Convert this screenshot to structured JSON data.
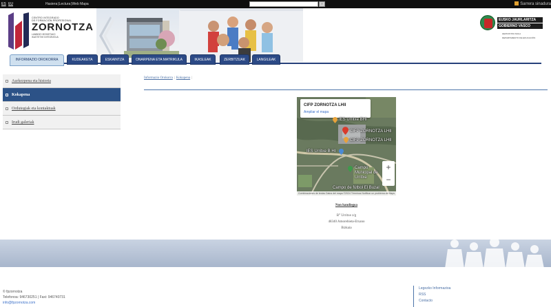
{
  "topbar": {
    "lang_es": "ES",
    "lang_eu": "EU",
    "links": [
      "Hasiera",
      "Lectura",
      "Web Mapa"
    ],
    "signature_link": "Sarrera sinadura"
  },
  "header": {
    "logo_line1": "CENTRO INTEGRADO",
    "logo_line2": "DE FORMACIÓN PROFESIONAL",
    "logo_name": "ZORNOTZA",
    "logo_line3": "LANBIDE HEZIKETAKO",
    "logo_line4": "IKASTETXE INTEGRATUA",
    "gv_line1": "EUSKO JAURLARITZA",
    "gv_line2": "GOBIERNO VASCO",
    "gv_sub1": "HEZKUNTZA SAILA",
    "gv_sub2": "DEPARTAMENTO DE EDUCACIÓN"
  },
  "nav": {
    "tabs": [
      {
        "label": "INFORMAZIO OROKORRA",
        "active": true
      },
      {
        "label": "KUDEAKETA",
        "active": false
      },
      {
        "label": "ESKAINTZA",
        "active": false
      },
      {
        "label": "ONARPENA ETA MATRIKULA",
        "active": false
      },
      {
        "label": "IKASLEAK",
        "active": false
      },
      {
        "label": "ZERBITZUAK",
        "active": false
      },
      {
        "label": "LANGILEAK",
        "active": false
      }
    ]
  },
  "sidebar": {
    "items": [
      {
        "label": "Aurkezpena eta historia",
        "active": false
      },
      {
        "label": "Kokapena",
        "active": true
      },
      {
        "label": "Ordutegiak eta kontaktuak",
        "active": false
      },
      {
        "label": "Irudi galeriak",
        "active": false
      }
    ]
  },
  "breadcrumb": {
    "items": [
      "Informazio Orokorra",
      "Kokapena"
    ],
    "separator": "|"
  },
  "map": {
    "card_title": "CIFP ZORNOTZA LHII",
    "card_link": "Ampliar el mapa",
    "labels": {
      "ies_urritxe": "IES Urritxe BHI",
      "cifp1": "CIFP ZORNOTZA LHII",
      "cifp2": "CIFP ZORNOTZA LHII",
      "ies_urritxe_b": "IES Urritxe B HI",
      "campo": "Campo Municipal de Urritxe",
      "campo_futbol": "Campo de fútbol El Buzal"
    },
    "zoom_in": "+",
    "zoom_out": "−",
    "footer": "Combinaciones de teclas   Datos del mapa ©2024   Términos   Notificar un problema de Maps",
    "colors": {
      "pin_red": "#d93a2b",
      "pin_orange": "#e8a23a",
      "pin_green": "#3d9a4b"
    }
  },
  "address": {
    "heading": "Non handiegoa",
    "line1": "B° Urritxe z/g",
    "line2": "48340 Amorebieta-Etxano",
    "line3": "Bizkaia"
  },
  "footer": {
    "copyright": "© fpzornotza",
    "phones": "Telefonoa: 946730251 | Faxi: 946740731",
    "email": "info@fpzornotza.com",
    "links": [
      "Legezko Informazioa",
      "RSS",
      "Contacto"
    ]
  }
}
